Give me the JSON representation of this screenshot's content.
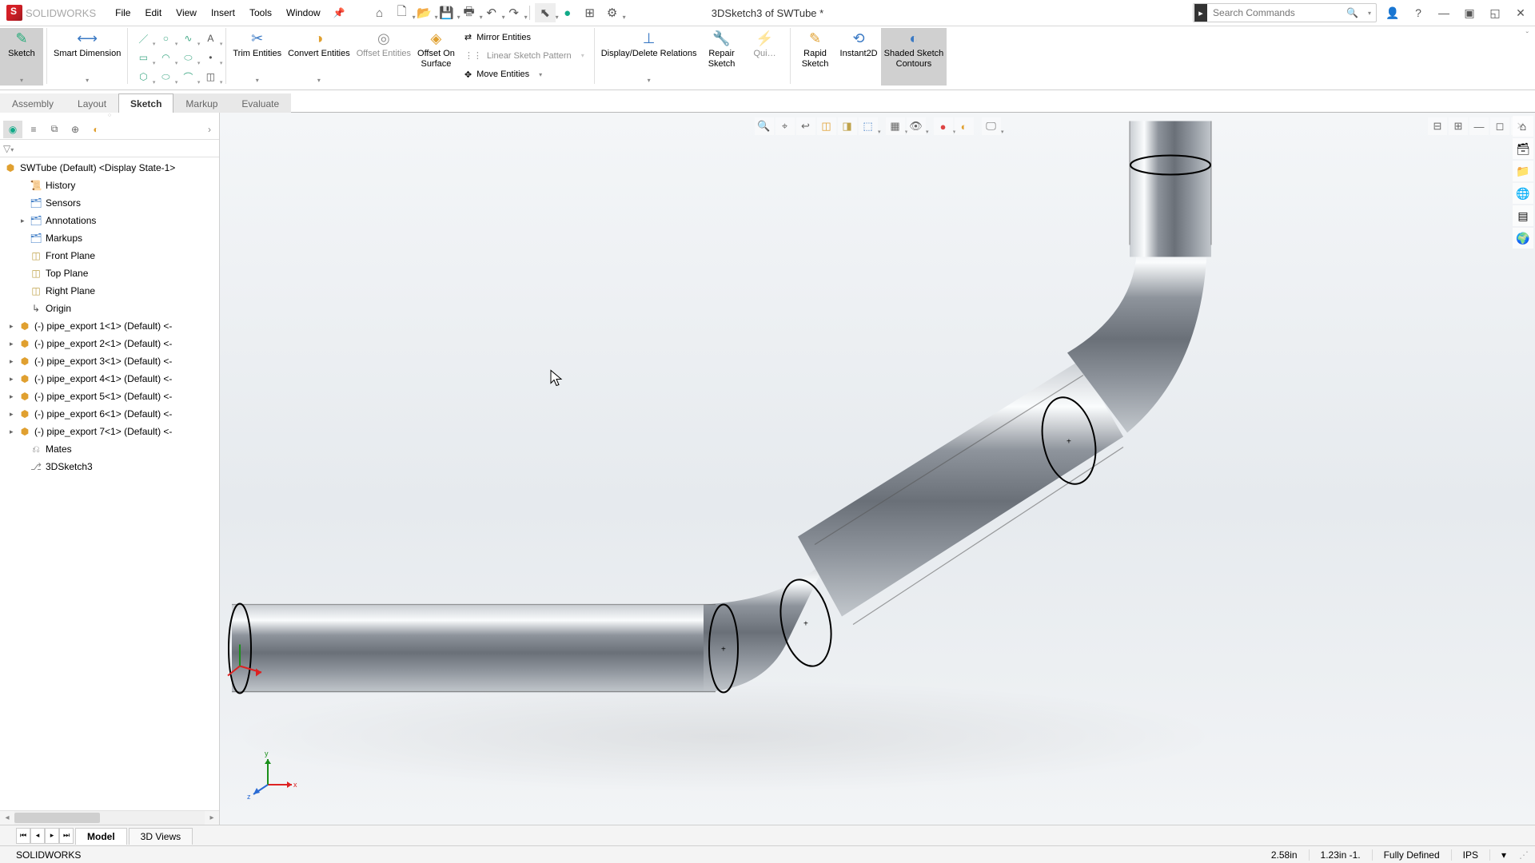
{
  "app": {
    "name": "SOLID",
    "name_suffix": "WORKS"
  },
  "menu": [
    "File",
    "Edit",
    "View",
    "Insert",
    "Tools",
    "Window"
  ],
  "document_title": "3DSketch3 of SWTube *",
  "search_placeholder": "Search Commands",
  "ribbon": {
    "sketch": "Sketch",
    "smart_dimension": "Smart Dimension",
    "trim": "Trim Entities",
    "convert": "Convert Entities",
    "offset": "Offset Entities",
    "offset_surface_l1": "Offset On",
    "offset_surface_l2": "Surface",
    "mirror": "Mirror Entities",
    "linear_pattern": "Linear Sketch Pattern",
    "move": "Move Entities",
    "display_relations": "Display/Delete Relations",
    "repair_l1": "Repair",
    "repair_l2": "Sketch",
    "quick": "Qui…",
    "rapid_l1": "Rapid",
    "rapid_l2": "Sketch",
    "instant": "Instant2D",
    "shaded_l1": "Shaded Sketch",
    "shaded_l2": "Contours"
  },
  "tabs": [
    "Assembly",
    "Layout",
    "Sketch",
    "Markup",
    "Evaluate"
  ],
  "active_tab": "Sketch",
  "tree_root": "SWTube (Default) <Display State-1>",
  "tree": [
    {
      "indent": 1,
      "arrow": "",
      "icon": "📜",
      "label": "History",
      "color": "#3a79c4"
    },
    {
      "indent": 1,
      "arrow": "",
      "icon": "🗂",
      "label": "Sensors",
      "color": "#3a79c4"
    },
    {
      "indent": 1,
      "arrow": "▸",
      "icon": "🗂",
      "label": "Annotations",
      "color": "#3a79c4"
    },
    {
      "indent": 1,
      "arrow": "",
      "icon": "🗂",
      "label": "Markups",
      "color": "#3a79c4"
    },
    {
      "indent": 1,
      "arrow": "",
      "icon": "◫",
      "label": "Front Plane",
      "color": "#bfa24a"
    },
    {
      "indent": 1,
      "arrow": "",
      "icon": "◫",
      "label": "Top Plane",
      "color": "#bfa24a"
    },
    {
      "indent": 1,
      "arrow": "",
      "icon": "◫",
      "label": "Right Plane",
      "color": "#bfa24a"
    },
    {
      "indent": 1,
      "arrow": "",
      "icon": "↳",
      "label": "Origin",
      "color": "#555"
    },
    {
      "indent": 0,
      "arrow": "▸",
      "icon": "⬢",
      "label": "(-) pipe_export 1<1> (Default) <-",
      "color": "#e0a030"
    },
    {
      "indent": 0,
      "arrow": "▸",
      "icon": "⬢",
      "label": "(-) pipe_export 2<1> (Default) <-",
      "color": "#e0a030"
    },
    {
      "indent": 0,
      "arrow": "▸",
      "icon": "⬢",
      "label": "(-) pipe_export 3<1> (Default) <-",
      "color": "#e0a030"
    },
    {
      "indent": 0,
      "arrow": "▸",
      "icon": "⬢",
      "label": "(-) pipe_export 4<1> (Default) <-",
      "color": "#e0a030"
    },
    {
      "indent": 0,
      "arrow": "▸",
      "icon": "⬢",
      "label": "(-) pipe_export 5<1> (Default) <-",
      "color": "#e0a030"
    },
    {
      "indent": 0,
      "arrow": "▸",
      "icon": "⬢",
      "label": "(-) pipe_export 6<1> (Default) <-",
      "color": "#e0a030"
    },
    {
      "indent": 0,
      "arrow": "▸",
      "icon": "⬢",
      "label": "(-) pipe_export 7<1> (Default) <-",
      "color": "#e0a030"
    },
    {
      "indent": 1,
      "arrow": "",
      "icon": "⎌",
      "label": "Mates",
      "color": "#888"
    },
    {
      "indent": 1,
      "arrow": "",
      "icon": "⎇",
      "label": "3DSketch3",
      "color": "#888"
    }
  ],
  "bottom_tabs": [
    "Model",
    "3D Views"
  ],
  "active_bottom_tab": "Model",
  "status": {
    "app": "SOLIDWORKS",
    "coord1": "2.58in",
    "coord2": "1.23in -1.",
    "defined": "Fully Defined",
    "units": "IPS"
  },
  "triad": {
    "x": "x",
    "y": "y",
    "z": "z"
  }
}
